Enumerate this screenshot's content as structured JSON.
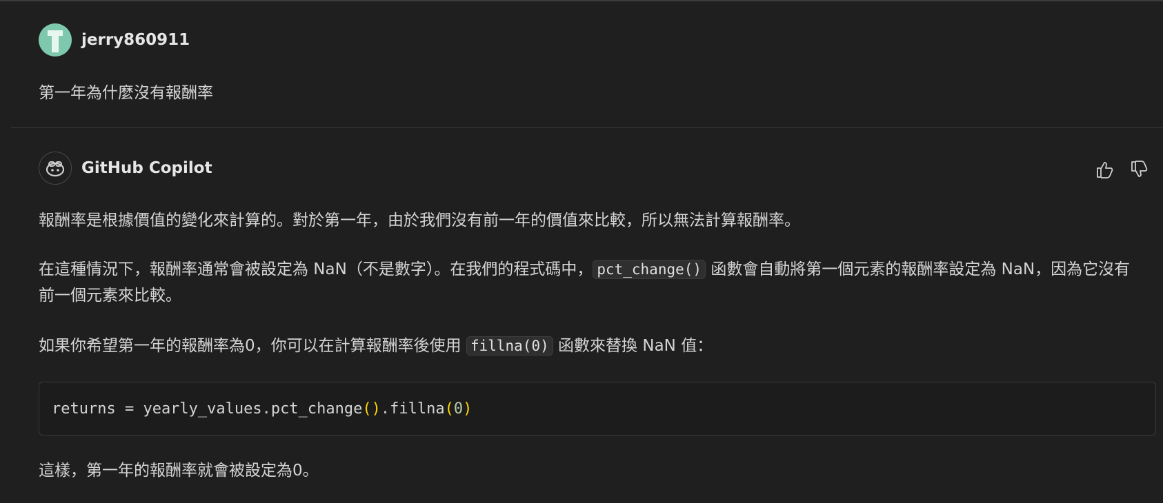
{
  "user_turn": {
    "username": "jerry860911",
    "message": "第一年為什麼沒有報酬率"
  },
  "assistant_turn": {
    "name": "GitHub Copilot",
    "para1": "報酬率是根據價值的變化來計算的。對於第一年，由於我們沒有前一年的價值來比較，所以無法計算報酬率。",
    "para2_a": "在這種情況下，報酬率通常會被設定為 NaN（不是數字）。在我們的程式碼中，",
    "para2_code": "pct_change()",
    "para2_b": " 函數會自動將第一個元素的報酬率設定為 NaN，因為它沒有前一個元素來比較。",
    "para3_a": "如果你希望第一年的報酬率為0，你可以在計算報酬率後使用 ",
    "para3_code": "fillna(0)",
    "para3_b": " 函數來替換 NaN 值：",
    "code": {
      "prefix": "returns = yearly_values.pct_change",
      "paren1": "()",
      "mid": ".fillna",
      "paren2_open": "(",
      "arg": "0",
      "paren2_close": ")"
    },
    "para4": "這樣，第一年的報酬率就會被設定為0。"
  },
  "icons": {
    "user_avatar": "user-avatar-icon",
    "copilot_avatar": "copilot-icon",
    "thumbs_up": "thumbs-up-icon",
    "thumbs_down": "thumbs-down-icon"
  },
  "colors": {
    "background": "#1f1f1f",
    "text": "#d4d4d4",
    "paren": "#ffd700",
    "number": "#b5cea8"
  }
}
